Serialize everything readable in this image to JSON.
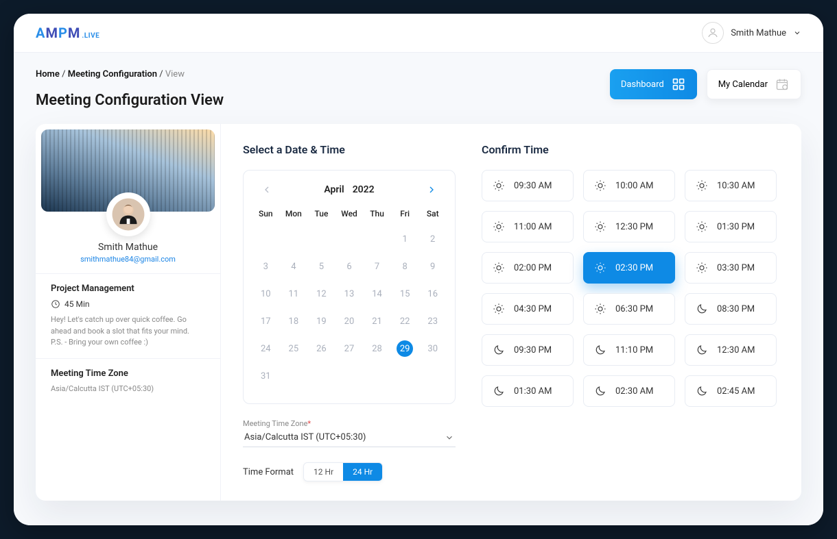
{
  "header": {
    "logo_text1": "AMPM",
    "logo_text2": ".LIVE",
    "user_name": "Smith Mathue"
  },
  "breadcrumb": {
    "home": "Home",
    "section": "Meeting Configuration",
    "current": "View"
  },
  "page_title": "Meeting Configuration View",
  "buttons": {
    "dashboard": "Dashboard",
    "my_calendar": "My Calendar"
  },
  "profile": {
    "name": "Smith Mathue",
    "email": "smithmathue84@gmail.com",
    "project_label": "Project Management",
    "duration": "45 Min",
    "description1": "Hey! Let's catch up over quick coffee. Go ahead and book a slot that fits your mind.",
    "description2": "P.S. - Bring your own coffee :)",
    "tz_label": "Meeting Time Zone",
    "tz_value": "Asia/Calcutta IST (UTC+05:30)"
  },
  "calendar": {
    "heading": "Select a Date & Time",
    "month": "April",
    "year": "2022",
    "dow": [
      "Sun",
      "Mon",
      "Tue",
      "Wed",
      "Thu",
      "Fri",
      "Sat"
    ],
    "days": [
      "1",
      "2",
      "3",
      "4",
      "5",
      "6",
      "7",
      "8",
      "9",
      "10",
      "11",
      "12",
      "13",
      "14",
      "15",
      "16",
      "17",
      "18",
      "19",
      "20",
      "21",
      "22",
      "23",
      "24",
      "25",
      "26",
      "27",
      "28",
      "29",
      "30",
      "31"
    ],
    "selected_day": "29",
    "tz_label": "Meeting Time Zone",
    "tz_value": "Asia/Calcutta IST (UTC+05:30)",
    "format_label": "Time Format",
    "format_12": "12 Hr",
    "format_24": "24 Hr"
  },
  "confirm": {
    "heading": "Confirm Time",
    "slots": [
      {
        "time": "09:30 AM",
        "phase": "day",
        "selected": false
      },
      {
        "time": "10:00 AM",
        "phase": "day",
        "selected": false
      },
      {
        "time": "10:30 AM",
        "phase": "day",
        "selected": false
      },
      {
        "time": "11:00 AM",
        "phase": "day",
        "selected": false
      },
      {
        "time": "12:30 PM",
        "phase": "day",
        "selected": false
      },
      {
        "time": "01:30 PM",
        "phase": "day",
        "selected": false
      },
      {
        "time": "02:00 PM",
        "phase": "day",
        "selected": false
      },
      {
        "time": "02:30 PM",
        "phase": "day",
        "selected": true
      },
      {
        "time": "03:30 PM",
        "phase": "day",
        "selected": false
      },
      {
        "time": "04:30 PM",
        "phase": "day",
        "selected": false
      },
      {
        "time": "06:30 PM",
        "phase": "day",
        "selected": false
      },
      {
        "time": "08:30 PM",
        "phase": "night",
        "selected": false
      },
      {
        "time": "09:30 PM",
        "phase": "night",
        "selected": false
      },
      {
        "time": "11:10 PM",
        "phase": "night",
        "selected": false
      },
      {
        "time": "12:30 AM",
        "phase": "night",
        "selected": false
      },
      {
        "time": "01:30 AM",
        "phase": "night",
        "selected": false
      },
      {
        "time": "02:30 AM",
        "phase": "night",
        "selected": false
      },
      {
        "time": "02:45 AM",
        "phase": "night",
        "selected": false
      }
    ]
  }
}
